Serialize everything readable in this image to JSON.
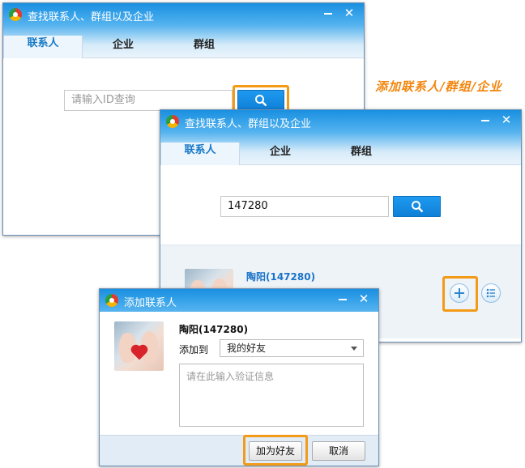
{
  "annotation": "添加联系人/群组/企业",
  "window1": {
    "title": "查找联系人、群组以及企业",
    "tabs": [
      "联系人",
      "企业",
      "群组"
    ],
    "search_placeholder": "请输入ID查询"
  },
  "window2": {
    "title": "查找联系人、群组以及企业",
    "tabs": [
      "联系人",
      "企业",
      "群组"
    ],
    "search_value": "147280",
    "result_name": "陶阳(147280)"
  },
  "dialog": {
    "title": "添加联系人",
    "name": "陶阳(147280)",
    "add_to_label": "添加到",
    "group_value": "我的好友",
    "message_placeholder": "请在此输入验证信息",
    "confirm_label": "加为好友",
    "cancel_label": "取消"
  },
  "icons": {
    "minimize": "minimize-icon",
    "close": "close-icon",
    "search": "search-icon",
    "add": "plus-icon",
    "list": "list-icon",
    "app": "app-logo-icon"
  },
  "colors": {
    "accent": "#1a8fe0",
    "highlight": "#f39a17",
    "annotation": "#f2850c"
  }
}
